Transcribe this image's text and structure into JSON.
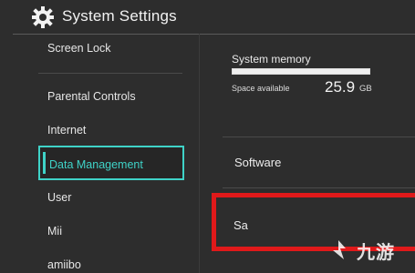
{
  "header": {
    "title": "System Settings",
    "icon": "gear-icon"
  },
  "sidebar": {
    "items": [
      {
        "label": "Screen Lock"
      },
      {
        "label": "Parental Controls"
      },
      {
        "label": "Internet"
      },
      {
        "label": "Data Management",
        "selected": true
      },
      {
        "label": "User"
      },
      {
        "label": "Mii"
      },
      {
        "label": "amiibo"
      }
    ]
  },
  "main": {
    "memory": {
      "label": "System memory",
      "space_label": "Space available",
      "space_value": "25.9",
      "space_unit": "GB"
    },
    "items": {
      "software": "Software",
      "save_partial": "Sa"
    }
  },
  "colors": {
    "accent": "#3fd3c8",
    "highlight": "#e0191a",
    "background": "#2d2d2d"
  },
  "watermark": {
    "text": "九游"
  }
}
